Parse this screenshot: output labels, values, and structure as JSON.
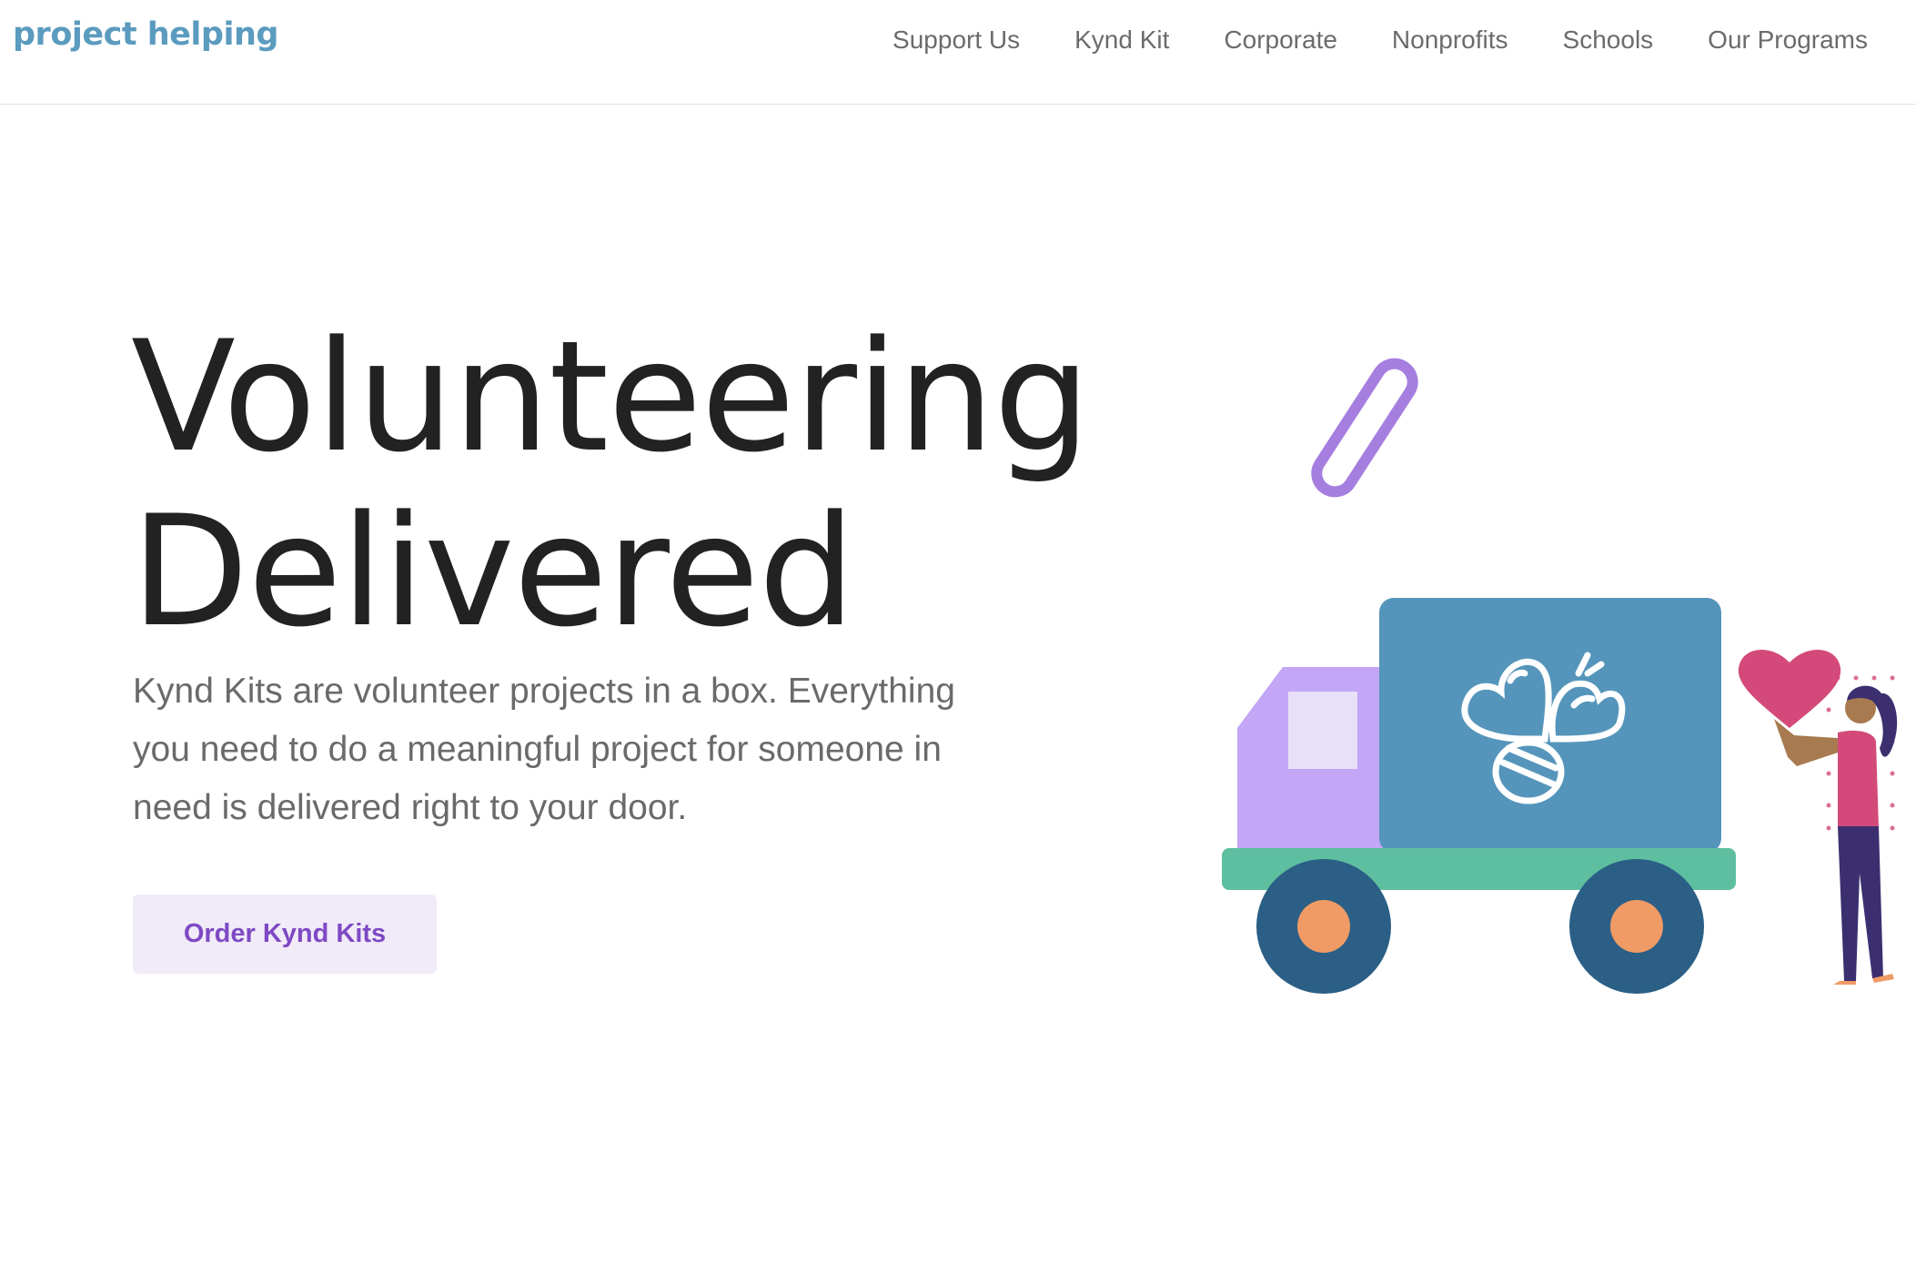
{
  "header": {
    "logo": "project helping",
    "nav": [
      "Support Us",
      "Kynd Kit",
      "Corporate",
      "Nonprofits",
      "Schools",
      "Our Programs"
    ]
  },
  "hero": {
    "title_line1": "Volunteering",
    "title_line2": "Delivered",
    "description": "Kynd Kits are volunteer projects in a box. Everything you need to do a meaningful project for someone in need is delivered right to your door.",
    "cta_label": "Order Kynd Kits"
  },
  "colors": {
    "logo": "#5b9bbf",
    "cta_text": "#7e49c4",
    "cta_bg": "#f1eaf8",
    "truck_box": "#5595bb",
    "truck_cab": "#c3a6f5",
    "truck_base": "#5dbf9f",
    "wheel": "#2b5f86",
    "hub": "#f09b65",
    "heart": "#d34a7a",
    "link_icon": "#a67ee0"
  },
  "icons": [
    "link-icon",
    "bee-logo-icon",
    "heart-icon",
    "delivery-truck-illustration",
    "person-illustration"
  ]
}
